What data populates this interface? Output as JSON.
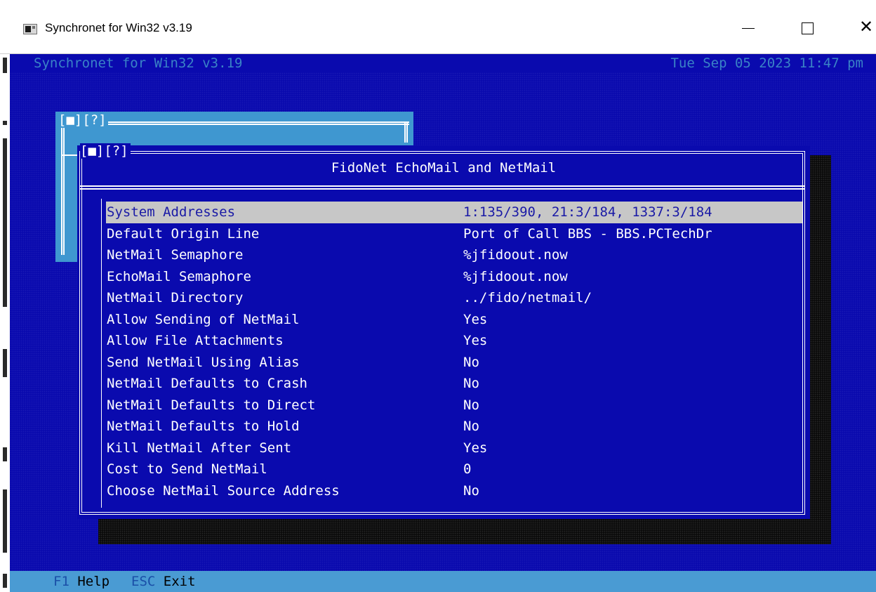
{
  "window": {
    "title": "Synchronet for Win32 v3.19",
    "minimize_glyph": "",
    "maximize_glyph": "",
    "close_glyph": "✕"
  },
  "terminal": {
    "top_left": "Synchronet for Win32 v3.19",
    "top_right": "Tue Sep 05 2023 11:47 pm",
    "colors": {
      "background": "#0a0aae",
      "selection": "#c7c7c7",
      "status_text": "#3a83c6",
      "status_bar": "#4a9bd3"
    }
  },
  "back_window": {
    "header": "[■][?]"
  },
  "dialog": {
    "header": "[■][?]",
    "title": "FidoNet EchoMail and NetMail",
    "items": [
      {
        "label": "System Addresses",
        "value": "1:135/390, 21:3/184, 1337:3/184"
      },
      {
        "label": "Default Origin Line",
        "value": "Port of Call BBS - BBS.PCTechDr"
      },
      {
        "label": "NetMail Semaphore",
        "value": "%jfidoout.now"
      },
      {
        "label": "EchoMail Semaphore",
        "value": "%jfidoout.now"
      },
      {
        "label": "NetMail Directory",
        "value": "../fido/netmail/"
      },
      {
        "label": "Allow Sending of NetMail",
        "value": "Yes"
      },
      {
        "label": "Allow File Attachments",
        "value": "Yes"
      },
      {
        "label": "Send NetMail Using Alias",
        "value": "No"
      },
      {
        "label": "NetMail Defaults to Crash",
        "value": "No"
      },
      {
        "label": "NetMail Defaults to Direct",
        "value": "No"
      },
      {
        "label": "NetMail Defaults to Hold",
        "value": "No"
      },
      {
        "label": "Kill NetMail After Sent",
        "value": "Yes"
      },
      {
        "label": "Cost to Send NetMail",
        "value": "0"
      },
      {
        "label": "Choose NetMail Source Address",
        "value": "No"
      }
    ],
    "selected_index": 0
  },
  "bottom_bar": {
    "f1_key": "F1",
    "f1_label": "Help",
    "esc_key": "ESC",
    "esc_label": "Exit"
  }
}
